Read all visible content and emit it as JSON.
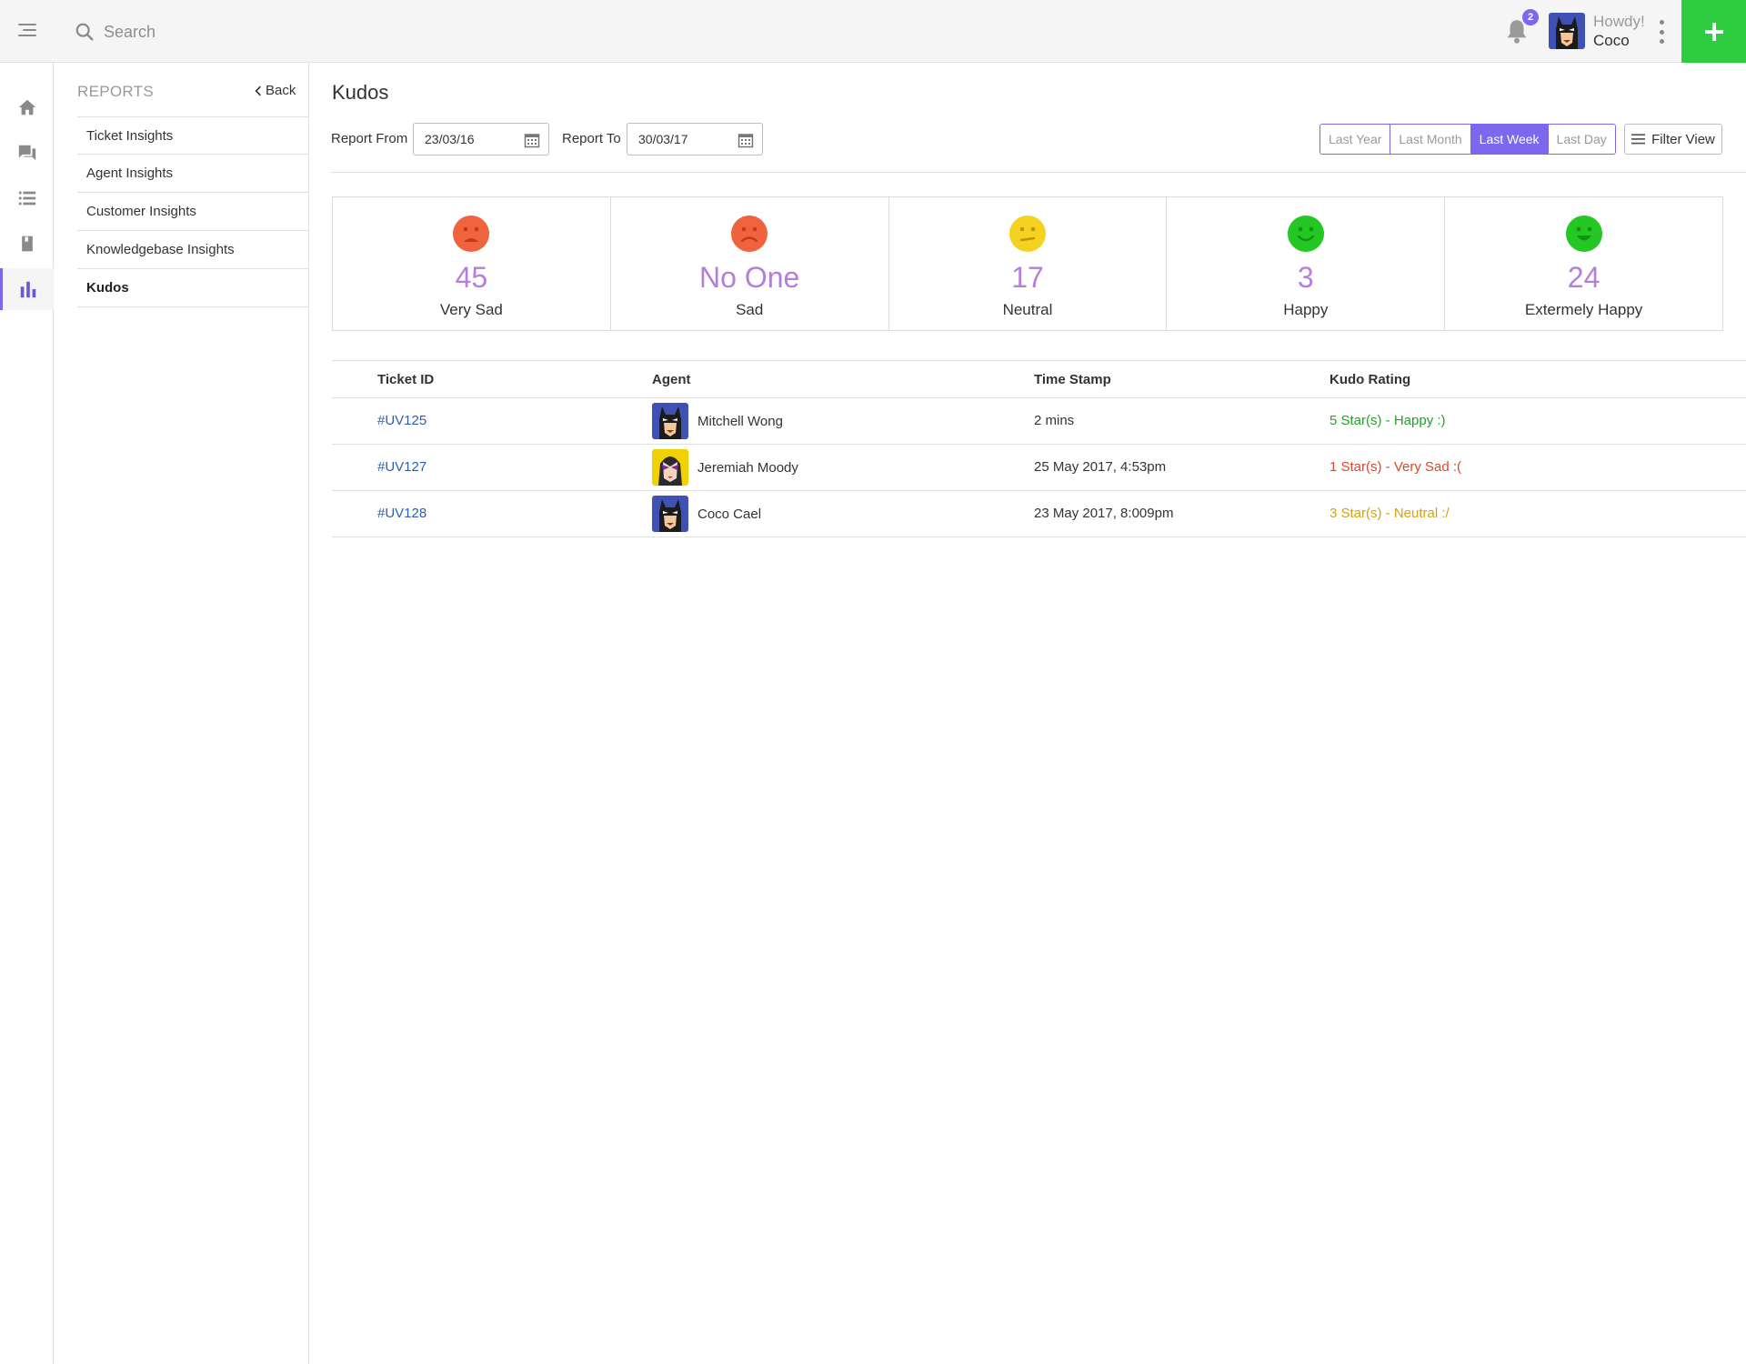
{
  "header": {
    "search_placeholder": "Search",
    "notification_count": "2",
    "greeting": "Howdy!",
    "user_name": "Coco"
  },
  "subnav": {
    "title": "REPORTS",
    "back_label": "Back",
    "items": [
      {
        "label": "Ticket Insights"
      },
      {
        "label": "Agent Insights"
      },
      {
        "label": "Customer Insights"
      },
      {
        "label": "Knowledgebase Insights"
      },
      {
        "label": "Kudos"
      }
    ]
  },
  "main": {
    "title": "Kudos",
    "report_from_label": "Report From",
    "report_from_value": "23/03/16",
    "report_to_label": "Report To",
    "report_to_value": "30/03/17",
    "ranges": [
      "Last Year",
      "Last Month",
      "Last Week",
      "Last Day"
    ],
    "active_range": "Last Week",
    "filter_view_label": "Filter View"
  },
  "stats": [
    {
      "value": "45",
      "label": "Very Sad",
      "color": "#f0633f"
    },
    {
      "value": "No One",
      "label": "Sad",
      "color": "#f0633f"
    },
    {
      "value": "17",
      "label": "Neutral",
      "color": "#f5d21f"
    },
    {
      "value": "3",
      "label": "Happy",
      "color": "#24c724"
    },
    {
      "value": "24",
      "label": "Extermely Happy",
      "color": "#24c724"
    }
  ],
  "table": {
    "headers": [
      "Ticket ID",
      "Agent",
      "Time Stamp",
      "Kudo Rating"
    ],
    "rows": [
      {
        "ticket": "#UV125",
        "agent": "Mitchell Wong",
        "avatar": "batman",
        "time": "2 mins",
        "rating": "5 Star(s) - Happy :)",
        "tone": "green"
      },
      {
        "ticket": "#UV127",
        "agent": "Jeremiah Moody",
        "avatar": "catwoman",
        "time": "25 May 2017, 4:53pm",
        "rating": "1 Star(s) - Very Sad :(",
        "tone": "red"
      },
      {
        "ticket": "#UV128",
        "agent": "Coco Cael",
        "avatar": "batman",
        "time": "23 May 2017, 8:009pm",
        "rating": "3 Star(s) - Neutral :/",
        "tone": "yellow"
      }
    ]
  },
  "colors": {
    "accent": "#7b68ee",
    "add_button": "#2ecc40",
    "stat_value": "#b57edc",
    "link": "#2c5fb0"
  }
}
